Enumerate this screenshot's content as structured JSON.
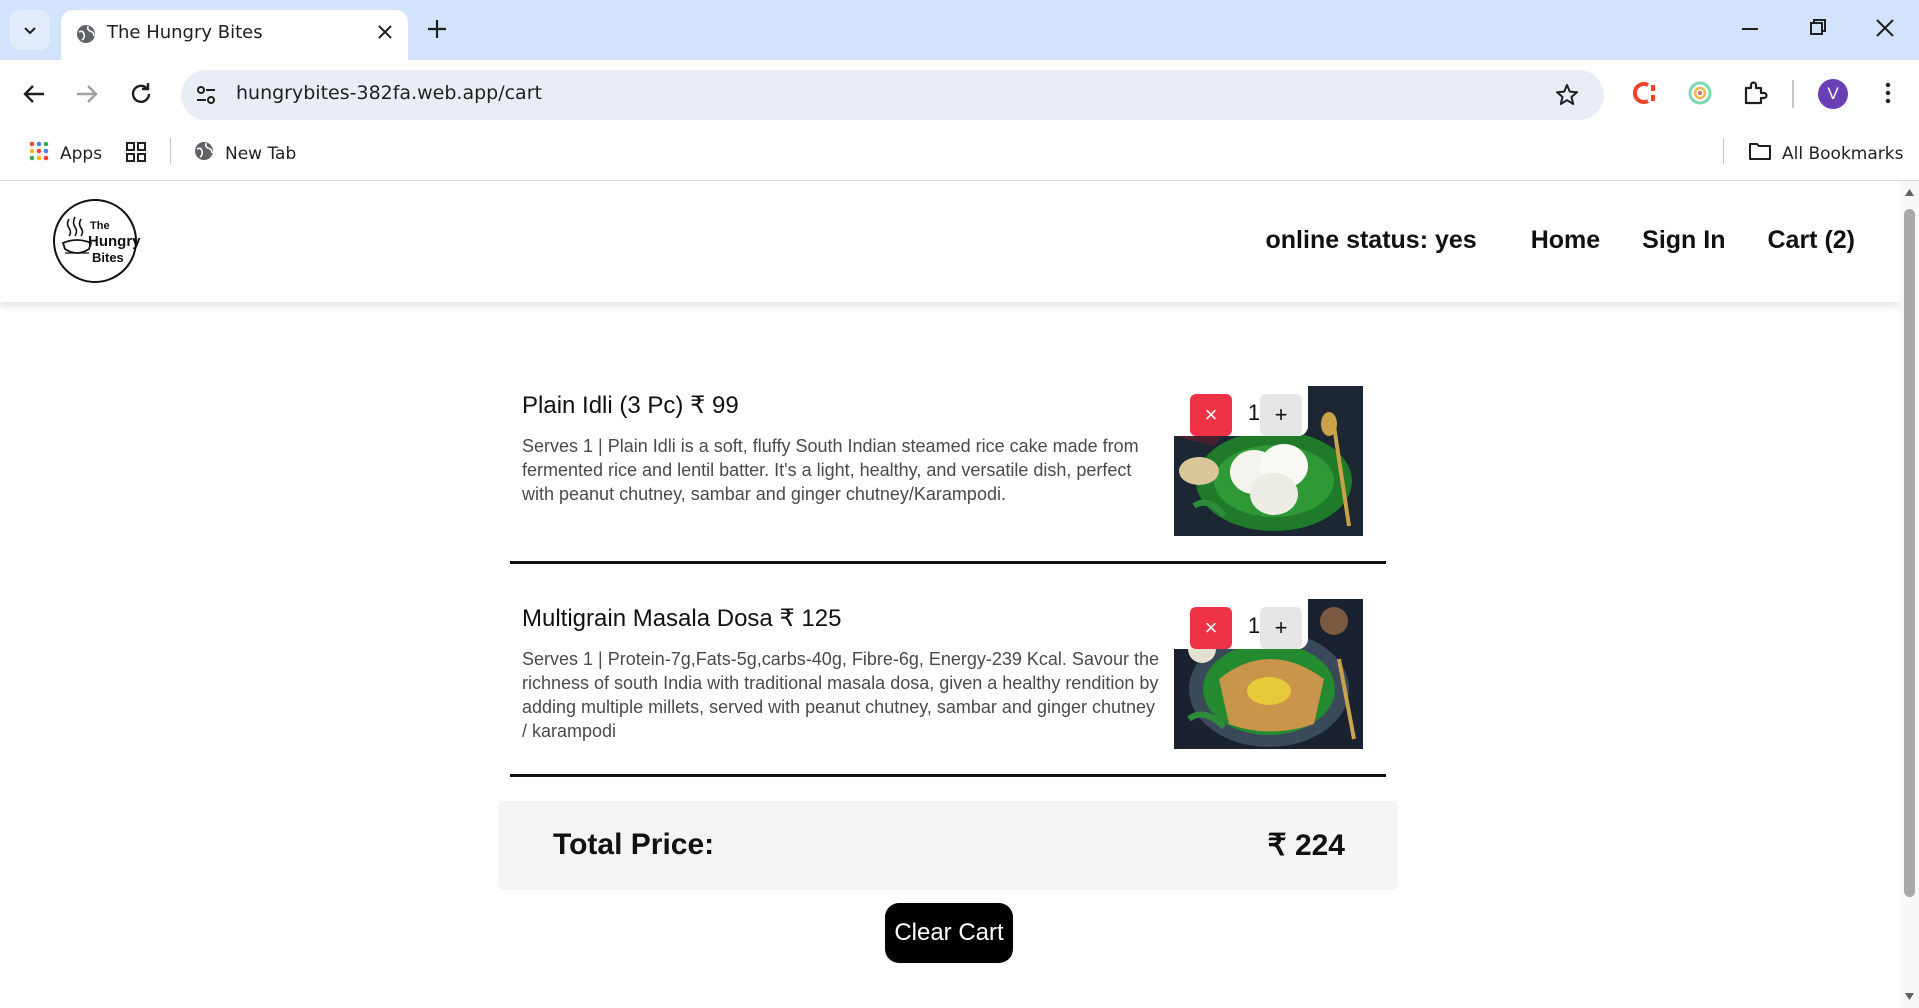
{
  "browser": {
    "tab_title": "The Hungry Bites",
    "url": "hungrybites-382fa.web.app/cart",
    "bookmarks": {
      "apps": "Apps",
      "new_tab": "New Tab",
      "all_bookmarks": "All Bookmarks"
    },
    "profile_initial": "V"
  },
  "site": {
    "logo_lines": [
      "The",
      "Hungry",
      "Bites"
    ],
    "nav": {
      "status": "online status: yes",
      "home": "Home",
      "sign_in": "Sign In",
      "cart": "Cart (2)"
    }
  },
  "cart": {
    "items": [
      {
        "name": "Plain Idli (3 Pc)",
        "price": "₹ 99",
        "description": "Serves 1 | Plain Idli is a soft, fluffy South Indian steamed rice cake made from fermented rice and lentil batter. It's a light, healthy, and versatile dish, perfect with peanut chutney, sambar and ginger chutney/Karampodi.",
        "quantity": "1",
        "remove_label": "×",
        "add_label": "+"
      },
      {
        "name": "Multigrain Masala Dosa",
        "price": "₹ 125",
        "description": "Serves 1 | Protein-7g,Fats-5g,carbs-40g, Fibre-6g, Energy-239 Kcal. Savour the richness of south India with traditional masala dosa, given a healthy rendition by adding multiple millets, served with peanut chutney, sambar and ginger chutney / karampodi",
        "quantity": "1",
        "remove_label": "×",
        "add_label": "+"
      }
    ],
    "total_label": "Total Price:",
    "total_value": "₹ 224",
    "clear_label": "Clear Cart"
  },
  "colors": {
    "remove_button": "#f03246",
    "chrome_tabbar": "#d3e3fd",
    "total_bg": "#f3f4f6"
  }
}
